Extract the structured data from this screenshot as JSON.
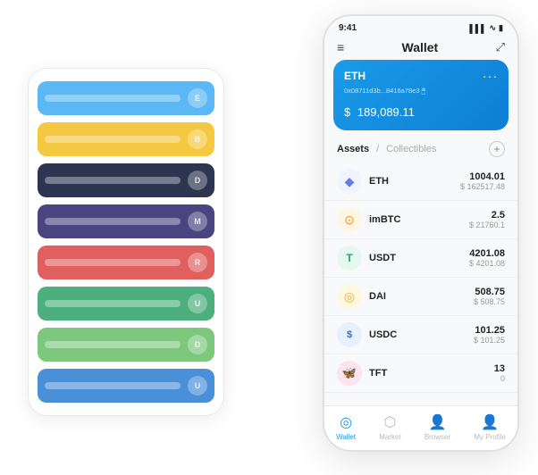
{
  "scene": {
    "card_stack": {
      "cards": [
        {
          "color": "#5bb8f5",
          "dot_label": "E"
        },
        {
          "color": "#f5c842",
          "dot_label": "B"
        },
        {
          "color": "#2d3550",
          "dot_label": "D"
        },
        {
          "color": "#4a4580",
          "dot_label": "M"
        },
        {
          "color": "#e06060",
          "dot_label": "R"
        },
        {
          "color": "#4caf7d",
          "dot_label": "U"
        },
        {
          "color": "#7dc87d",
          "dot_label": "D"
        },
        {
          "color": "#4a90d9",
          "dot_label": "U"
        }
      ]
    },
    "phone": {
      "status_bar": {
        "time": "9:41",
        "signal": "▌▌▌",
        "wifi": "WiFi",
        "battery": "🔋"
      },
      "header": {
        "menu_icon": "☰",
        "title": "Wallet",
        "expand_icon": "⤢"
      },
      "eth_card": {
        "label": "ETH",
        "address": "0x08711d3b...8416a78e3 🖱",
        "dots": "...",
        "currency_symbol": "$",
        "balance": "189,089.11"
      },
      "assets_header": {
        "tab_active": "Assets",
        "divider": "/",
        "tab_inactive": "Collectibles",
        "add_icon": "+"
      },
      "assets": [
        {
          "symbol": "ETH",
          "icon_char": "◆",
          "icon_class": "icon-eth",
          "balance": "1004.01",
          "usd": "$ 162517.48"
        },
        {
          "symbol": "imBTC",
          "icon_char": "⊙",
          "icon_class": "icon-imbtc",
          "balance": "2.5",
          "usd": "$ 21760.1"
        },
        {
          "symbol": "USDT",
          "icon_char": "T",
          "icon_class": "icon-usdt",
          "balance": "4201.08",
          "usd": "$ 4201.08"
        },
        {
          "symbol": "DAI",
          "icon_char": "◎",
          "icon_class": "icon-dai",
          "balance": "508.75",
          "usd": "$ 508.75"
        },
        {
          "symbol": "USDC",
          "icon_char": "$",
          "icon_class": "icon-usdc",
          "balance": "101.25",
          "usd": "$ 101.25"
        },
        {
          "symbol": "TFT",
          "icon_char": "🦋",
          "icon_class": "icon-tft",
          "balance": "13",
          "usd": "0"
        }
      ],
      "bottom_nav": [
        {
          "label": "Wallet",
          "icon": "◎",
          "active": true
        },
        {
          "label": "Market",
          "icon": "📊",
          "active": false
        },
        {
          "label": "Browser",
          "icon": "👤",
          "active": false
        },
        {
          "label": "My Profile",
          "icon": "👤",
          "active": false
        }
      ]
    }
  }
}
